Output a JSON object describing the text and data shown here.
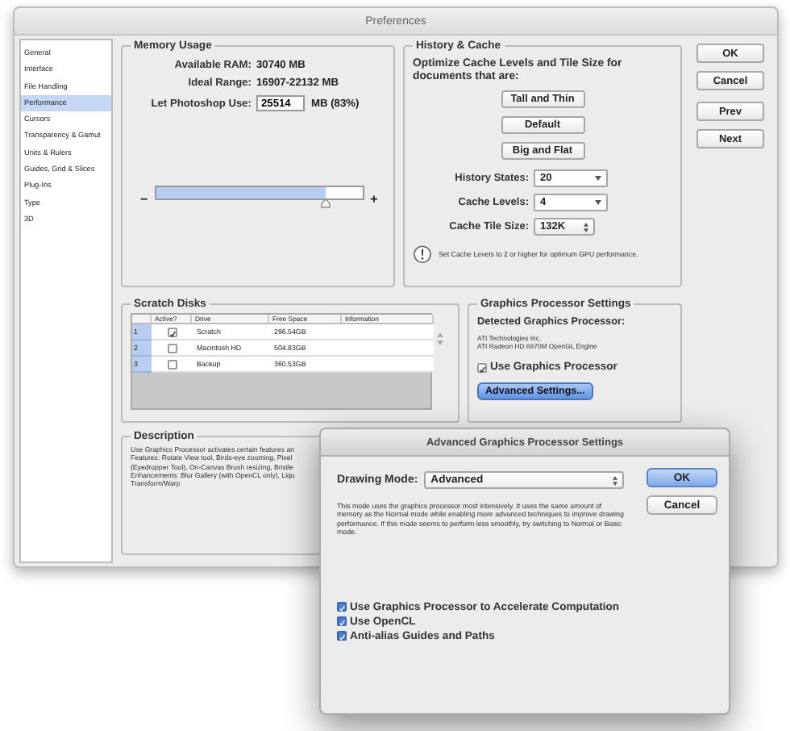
{
  "window": {
    "title": "Preferences"
  },
  "sidebar": {
    "items": [
      {
        "label": "General",
        "selected": false
      },
      {
        "label": "Interface",
        "selected": false
      },
      {
        "label": "File Handling",
        "selected": false
      },
      {
        "label": "Performance",
        "selected": true
      },
      {
        "label": "Cursors",
        "selected": false
      },
      {
        "label": "Transparency & Gamut",
        "selected": false
      },
      {
        "label": "Units & Rulers",
        "selected": false
      },
      {
        "label": "Guides, Grid & Slices",
        "selected": false
      },
      {
        "label": "Plug-Ins",
        "selected": false
      },
      {
        "label": "Type",
        "selected": false
      },
      {
        "label": "3D",
        "selected": false
      }
    ]
  },
  "memory_usage": {
    "title": "Memory Usage",
    "rows": [
      {
        "label": "Available RAM:",
        "value": "30740 MB"
      },
      {
        "label": "Ideal Range:",
        "value": "16907-22132 MB"
      }
    ],
    "use": {
      "label": "Let Photoshop Use:",
      "value": "25514",
      "unit": "MB (83%)"
    },
    "slider": {
      "minus": "−",
      "plus": "+",
      "level": 0.82
    }
  },
  "history_cache": {
    "title": "History & Cache",
    "intro": "Optimize Cache Levels and Tile Size for documents that are:",
    "presets": [
      "Tall and Thin",
      "Default",
      "Big and Flat"
    ],
    "fields": [
      {
        "label": "History States:",
        "value": "20",
        "kind": "dropdown"
      },
      {
        "label": "Cache Levels:",
        "value": "4",
        "kind": "dropdown"
      },
      {
        "label": "Cache Tile Size:",
        "value": "132K",
        "kind": "stepper"
      }
    ],
    "note": "Set Cache Levels to 2 or higher for optimum GPU performance."
  },
  "buttons": [
    "OK",
    "Cancel",
    "Prev",
    "Next"
  ],
  "scratch_disks": {
    "title": "Scratch Disks",
    "columns": [
      "Active?",
      "Drive",
      "Free Space",
      "Information"
    ],
    "rows": [
      {
        "number": "1",
        "active": true,
        "drive": "Scratch",
        "free_space": "296.54GB"
      },
      {
        "number": "2",
        "active": false,
        "drive": "Macintosh HD",
        "free_space": "504.83GB"
      },
      {
        "number": "3",
        "active": false,
        "drive": "Backup",
        "free_space": "360.53GB"
      }
    ]
  },
  "graphics_processor": {
    "title": "Graphics Processor Settings",
    "detected_label": "Detected Graphics Processor:",
    "vendor": "ATI Technologies Inc.",
    "renderer": "ATI Radeon HD 6970M OpenGL Engine",
    "use_gpu": {
      "label": "Use Graphics Processor",
      "checked": true
    },
    "advanced_button": "Advanced Settings..."
  },
  "description": {
    "title": "Description",
    "lines": [
      "Use Graphics Processor activates certain features an",
      "Features: Rotate View tool, Birds-eye zooming, Pixel",
      "(Eyedropper Tool), On-Canvas Brush resizing, Bristle",
      "Enhancements: Blur Gallery (with OpenCL only), Liqu",
      "Transform/Warp"
    ]
  },
  "dialog": {
    "title": "Advanced Graphics Processor Settings",
    "drawing_mode": {
      "label": "Drawing Mode:",
      "value": "Advanced"
    },
    "text": "This mode uses the graphics processor most intensively.  It uses the same amount of memory as the Normal mode while enabling more advanced techniques to improve drawing performance.  If this mode seems to perform less smoothly, try switching to Normal or Basic mode.",
    "buttons": [
      {
        "label": "OK",
        "default": true
      },
      {
        "label": "Cancel",
        "default": false
      }
    ],
    "options": [
      {
        "label": "Use Graphics Processor to Accelerate Computation",
        "checked": true
      },
      {
        "label": "Use OpenCL",
        "checked": true
      },
      {
        "label": "Anti-alias Guides and Paths",
        "checked": true
      }
    ]
  }
}
